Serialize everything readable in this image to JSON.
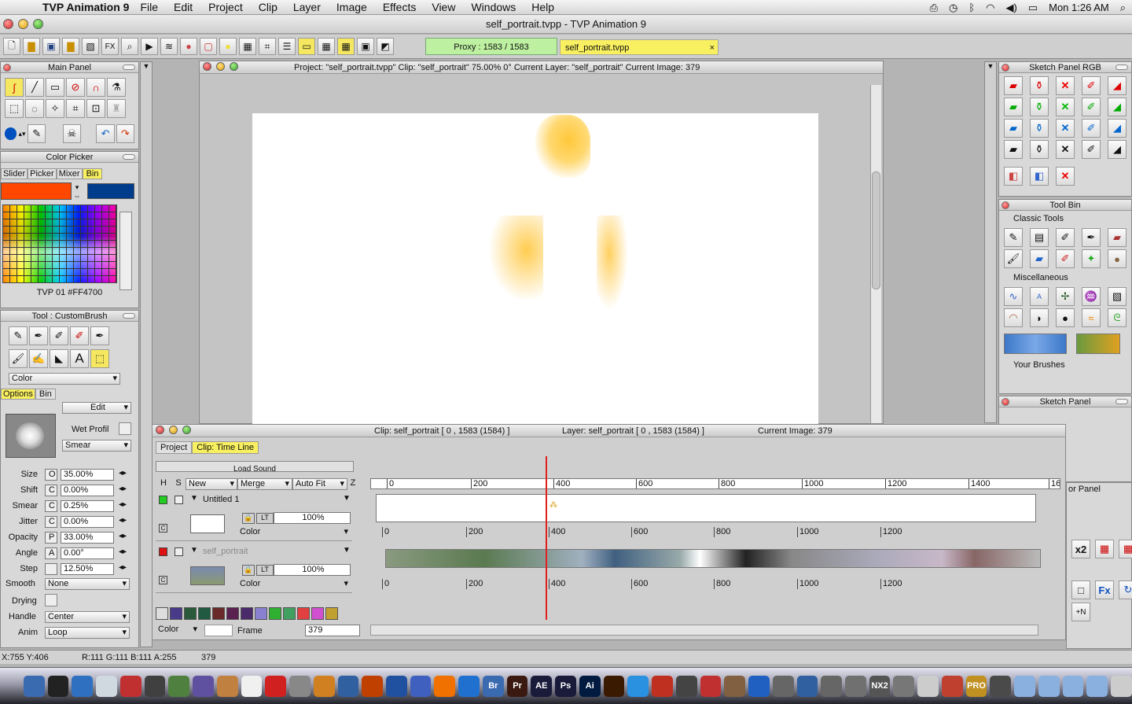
{
  "menubar": {
    "app": "TVP Animation 9",
    "items": [
      "File",
      "Edit",
      "Project",
      "Clip",
      "Layer",
      "Image",
      "Effects",
      "View",
      "Windows",
      "Help"
    ],
    "clock": "Mon 1:26 AM"
  },
  "window": {
    "title": "self_portrait.tvpp - TVP Animation 9"
  },
  "toolbar": {
    "fx": "FX",
    "proxy": "Proxy : 1583 / 1583",
    "file_tab": "self_portrait.tvpp",
    "close": "×"
  },
  "main_panel": {
    "title": "Main Panel"
  },
  "color_picker": {
    "title": "Color Picker",
    "tabs": [
      "Slider",
      "Picker",
      "Mixer",
      "Bin"
    ],
    "active_tab": "Bin",
    "primary": "#FF4700",
    "secondary": "#003c8c",
    "color_name": "TVP 01 #FF4700"
  },
  "tool_panel": {
    "title": "Tool : CustomBrush",
    "mode": "Color",
    "tabs": [
      "Options",
      "Bin"
    ],
    "active_tab": "Options",
    "edit": "Edit",
    "wet": "Wet Profil",
    "smear_mode": "Smear",
    "params": [
      {
        "label": "Size",
        "flag": "O",
        "value": "35.00%"
      },
      {
        "label": "Shift",
        "flag": "C",
        "value": "0.00%"
      },
      {
        "label": "Smear",
        "flag": "C",
        "value": "0.25%"
      },
      {
        "label": "Jitter",
        "flag": "C",
        "value": "0.00%"
      },
      {
        "label": "Opacity",
        "flag": "P",
        "value": "33.00%"
      },
      {
        "label": "Angle",
        "flag": "A",
        "value": "0.00°"
      },
      {
        "label": "Step",
        "flag": "",
        "value": "12.50%"
      }
    ],
    "smooth_label": "Smooth",
    "smooth": "None",
    "drying_label": "Drying",
    "handle_label": "Handle",
    "handle": "Center",
    "anim_label": "Anim",
    "anim": "Loop"
  },
  "canvas": {
    "header": "Project:  \"self_portrait.tvpp\"  Clip: \"self_portrait\"   75.00%   0°  Current Layer: \"self_portrait\"  Current Image: 379"
  },
  "timeline": {
    "header_clip": "Clip: self_portrait [ 0 , 1583  (1584) ]",
    "header_layer": "Layer: self_portrait [ 0 , 1583  (1584) ]",
    "header_image": "Current Image: 379",
    "tabs": [
      "Project",
      "Clip: Time Line"
    ],
    "active_tab": "Clip: Time Line",
    "load_sound": "Load Sound",
    "cols": {
      "h": "H",
      "s": "S",
      "new": "New",
      "merge": "Merge",
      "autofit": "Auto Fit",
      "z": "Z"
    },
    "ticks": [
      "0",
      "200",
      "400",
      "600",
      "800",
      "1000",
      "1200",
      "1400",
      "16"
    ],
    "layers": [
      {
        "name": "Untitled 1",
        "opacity": "100%",
        "mode": "Color",
        "lt": "LT",
        "c": "C",
        "color": "#22cc22"
      },
      {
        "name": "self_portrait",
        "opacity": "100%",
        "mode": "Color",
        "lt": "LT",
        "c": "C",
        "color": "#dd1111"
      }
    ],
    "footer": {
      "color": "Color",
      "frame": "Frame",
      "frame_value": "379"
    }
  },
  "sketch_rgb": {
    "title": "Sketch Panel RGB"
  },
  "tool_bin": {
    "title": "Tool Bin",
    "classic": "Classic Tools",
    "misc": "Miscellaneous",
    "brushes": "Your Brushes"
  },
  "sketch_panel": {
    "title": "Sketch Panel",
    "sub": "or Panel",
    "x2": "x2",
    "fx": "Fx",
    "n": "+N"
  },
  "status": {
    "coords": "X:755  Y:406",
    "rgba": "R:111 G:111 B:111 A:255",
    "frame": "379"
  },
  "dock": [
    "Br",
    "Pr",
    "AE",
    "Ps",
    "Ai",
    "NX2",
    "PRO"
  ]
}
